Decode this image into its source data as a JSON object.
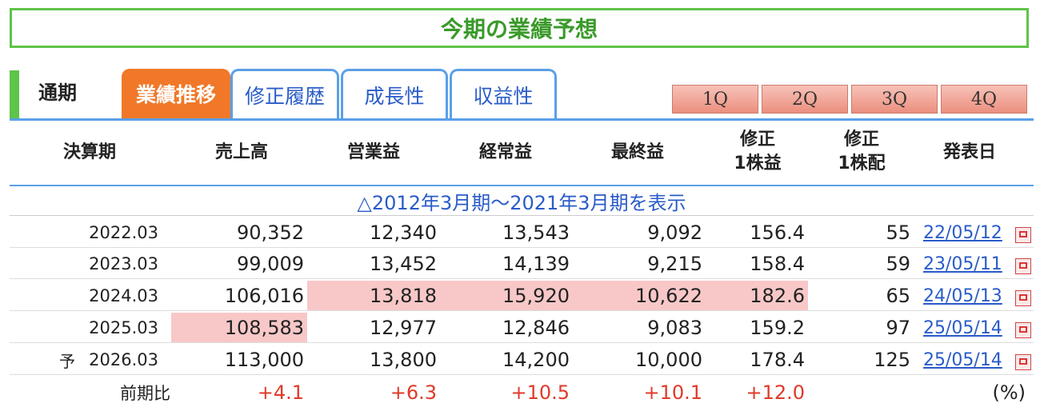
{
  "title": "今期の業績予想",
  "tabs": {
    "plain": "通期",
    "active": "業績推移",
    "items": [
      "修正履歴",
      "成長性",
      "収益性"
    ]
  },
  "quarters": [
    "1Q",
    "2Q",
    "3Q",
    "4Q"
  ],
  "headers": {
    "period": "決算期",
    "sales": "売上高",
    "operating": "営業益",
    "ordinary": "経常益",
    "net": "最終益",
    "eps_line1": "修正",
    "eps_line2": "1株益",
    "dps_line1": "修正",
    "dps_line2": "1株配",
    "date": "発表日"
  },
  "range_link": "△2012年3月期〜2021年3月期を表示",
  "rows": [
    {
      "period": "2022.03",
      "sales": "90,352",
      "operating": "12,340",
      "ordinary": "13,543",
      "net": "9,092",
      "eps": "156.4",
      "dps": "55",
      "date": "22/05/12"
    },
    {
      "period": "2023.03",
      "sales": "99,009",
      "operating": "13,452",
      "ordinary": "14,139",
      "net": "9,215",
      "eps": "158.4",
      "dps": "59",
      "date": "23/05/11"
    },
    {
      "period": "2024.03",
      "sales": "106,016",
      "operating": "13,818",
      "ordinary": "15,920",
      "net": "10,622",
      "eps": "182.6",
      "dps": "65",
      "date": "24/05/13"
    },
    {
      "period": "2025.03",
      "sales": "108,583",
      "operating": "12,977",
      "ordinary": "12,846",
      "net": "9,083",
      "eps": "159.2",
      "dps": "97",
      "date": "25/05/14"
    },
    {
      "prefix": "予",
      "period": "2026.03",
      "sales": "113,000",
      "operating": "13,800",
      "ordinary": "14,200",
      "net": "10,000",
      "eps": "178.4",
      "dps": "125",
      "date": "25/05/14"
    }
  ],
  "yoy": {
    "label": "前期比",
    "sales": "+4.1",
    "operating": "+6.3",
    "ordinary": "+10.5",
    "net": "+10.1",
    "eps": "+12.0",
    "unit": "(%)"
  },
  "colors": {
    "green": "#5ec44a",
    "orange": "#f07828",
    "blue": "#2a5cc8",
    "highlight": "#f8c8c8",
    "red": "#e03a2a"
  }
}
